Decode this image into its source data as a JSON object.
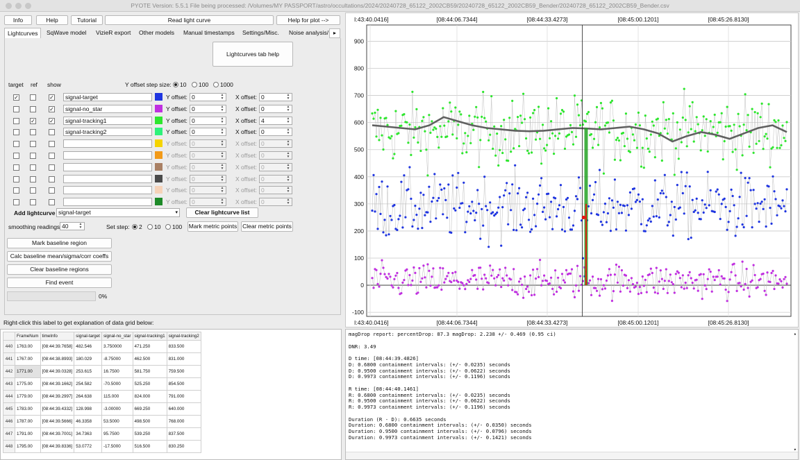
{
  "window": {
    "title": "PYOTE Version: 5.5.1  File being processed: /Volumes/MY PASSPORT/astro/occultations/2024/20240728_65122_2002CB59/20240728_65122_2002CB59_Bender/20240728_65122_2002CB59_Bender.csv"
  },
  "toolbar": {
    "info": "Info",
    "help": "Help",
    "tutorial": "Tutorial",
    "read_light_curve": "Read light curve",
    "help_for_plot": "Help for plot -->"
  },
  "tabs": [
    "Lightcurves",
    "SqWave model",
    "VizieR export",
    "Other models",
    "Manual timestamps",
    "Settings/Misc.",
    "Noise analysis/"
  ],
  "tab_help_button": "Lightcurves tab help",
  "lc_headers": {
    "target": "target",
    "ref": "ref",
    "show": "show"
  },
  "offset_step": {
    "label": "Y offset step size:",
    "options": [
      "10",
      "100",
      "1000"
    ]
  },
  "y_offset_label": "Y offset:",
  "x_offset_label": "X offset:",
  "curves": [
    {
      "name": "signal-target",
      "target": true,
      "ref": false,
      "show": true,
      "color": "#1f35e0",
      "yoff": "0",
      "xoff": "0",
      "enabled": true
    },
    {
      "name": "signal-no_star",
      "target": false,
      "ref": false,
      "show": true,
      "color": "#c02fe0",
      "yoff": "0",
      "xoff": "0",
      "enabled": true
    },
    {
      "name": "signal-tracking1",
      "target": false,
      "ref": true,
      "show": true,
      "color": "#2ee62e",
      "yoff": "0",
      "xoff": "4",
      "enabled": true
    },
    {
      "name": "signal-tracking2",
      "target": false,
      "ref": false,
      "show": false,
      "color": "#2ef27a",
      "yoff": "0",
      "xoff": "0",
      "enabled": true
    },
    {
      "name": "",
      "target": false,
      "ref": false,
      "show": false,
      "color": "#f5d400",
      "yoff": "0",
      "xoff": "0",
      "enabled": false
    },
    {
      "name": "",
      "target": false,
      "ref": false,
      "show": false,
      "color": "#f29a18",
      "yoff": "0",
      "xoff": "0",
      "enabled": false
    },
    {
      "name": "",
      "target": false,
      "ref": false,
      "show": false,
      "color": "#a98064",
      "yoff": "0",
      "xoff": "0",
      "enabled": false
    },
    {
      "name": "",
      "target": false,
      "ref": false,
      "show": false,
      "color": "#4a4a4a",
      "yoff": "0",
      "xoff": "0",
      "enabled": false
    },
    {
      "name": "",
      "target": false,
      "ref": false,
      "show": false,
      "color": "#f6d2b8",
      "yoff": "0",
      "xoff": "0",
      "enabled": false
    },
    {
      "name": "",
      "target": false,
      "ref": false,
      "show": false,
      "color": "#1d8a28",
      "yoff": "0",
      "xoff": "0",
      "enabled": false
    }
  ],
  "add_lightcurve": {
    "label": "Add lightcurve",
    "value": "signal-target"
  },
  "clear_lightcurve_list": "Clear lightcurve list",
  "smoothing": {
    "label": "smoothing readings",
    "value": "40"
  },
  "set_step": {
    "label": "Set step:",
    "options": [
      "2",
      "10",
      "100"
    ]
  },
  "mark_metric_points": "Mark metric points",
  "clear_metric_points": "Clear metric points",
  "actions": [
    "Mark baseline region",
    "Calc baseline mean/sigma/corr coeffs",
    "Clear baseline regions",
    "Find event"
  ],
  "progress": {
    "value": 0,
    "text": "0%"
  },
  "grid_hint": "Right-click this label to get explanation of data grid below:",
  "grid": {
    "columns": [
      "FrameNum",
      "timeInfo",
      "signal-target",
      "signal-no_star",
      "signal-tracking1",
      "signal-tracking2"
    ],
    "rows": [
      {
        "n": "440",
        "cells": [
          "1763.00",
          "[08:44:39.7658]",
          "482.546",
          "3.750000",
          "471.250",
          "833.500"
        ]
      },
      {
        "n": "441",
        "cells": [
          "1767.00",
          "[08:44:38.8993]",
          "180.029",
          "-8.75000",
          "462.500",
          "831.000"
        ]
      },
      {
        "n": "442",
        "cells": [
          "1771.00",
          "[08:44:39.0328]",
          "253.615",
          "16.7500",
          "581.750",
          "759.500"
        ]
      },
      {
        "n": "443",
        "cells": [
          "1775.00",
          "[08:44:39.1662]",
          "254.582",
          "-70.5000",
          "525.250",
          "854.500"
        ]
      },
      {
        "n": "444",
        "cells": [
          "1779.00",
          "[08:44:39.2997]",
          "264.638",
          "115.000",
          "824.000",
          "791.000"
        ]
      },
      {
        "n": "445",
        "cells": [
          "1783.00",
          "[08:44:39.4332]",
          "128.998",
          "-3.00000",
          "669.250",
          "640.000"
        ]
      },
      {
        "n": "446",
        "cells": [
          "1787.00",
          "[08:44:39.5666]",
          "46.3358",
          "53.5000",
          "498.500",
          "768.000"
        ]
      },
      {
        "n": "447",
        "cells": [
          "1791.00",
          "[08:44:39.7001]",
          "34.7363",
          "95.7500",
          "539.250",
          "837.500"
        ]
      },
      {
        "n": "448",
        "cells": [
          "1795.00",
          "[08:44:39.8336]",
          "53.0772",
          "-17.5000",
          "516.500",
          "830.250"
        ]
      }
    ]
  },
  "report_lines": [
    "magDrop report: percentDrop: 87.3 magDrop: 2.238 +/- 0.469 (0.95 ci)",
    "",
    "DNR: 3.49",
    "",
    "D time: [08:44:39.4826]",
    "D: 0.6800 containment intervals: (+/- 0.0235) seconds",
    "D: 0.9500 containment intervals: (+/- 0.0622) seconds",
    "D: 0.9973 containment intervals: (+/- 0.1196) seconds",
    "",
    "R time: [08:44:40.1461]",
    "R: 0.6800 containment intervals: (+/- 0.0235) seconds",
    "R: 0.9500 containment intervals: (+/- 0.0622) seconds",
    "R: 0.9973 containment intervals: (+/- 0.1196) seconds",
    "",
    "Duration (R - D): 0.6635 seconds",
    "Duration: 0.6800 containment intervals: (+/- 0.0350) seconds",
    "Duration: 0.9500 containment intervals: (+/- 0.0796) seconds",
    "Duration: 0.9973 containment intervals: (+/- 0.1421) seconds"
  ],
  "chart_data": {
    "type": "scatter",
    "x_tick_labels": [
      "I:43:40.0416]",
      "[08:44:06.7344]",
      "[08:44:33.4273]",
      "[08:45:00.1201]",
      "[08:45:26.8130]"
    ],
    "y_ticks": [
      -100,
      0,
      100,
      200,
      300,
      400,
      500,
      600,
      700,
      800,
      900
    ],
    "ylim": [
      -115,
      960
    ],
    "grid": true,
    "series": [
      {
        "name": "signal-tracking1",
        "color": "#2ee62e",
        "mean": 570,
        "spread": 90
      },
      {
        "name": "signal-target",
        "color": "#1f35e0",
        "mean": 290,
        "spread": 85
      },
      {
        "name": "signal-no_star",
        "color": "#c02fe0",
        "mean": 15,
        "spread": 45
      }
    ],
    "smoothed_mean": [
      590,
      585,
      580,
      575,
      590,
      620,
      605,
      590,
      580,
      575,
      570,
      568,
      570,
      575,
      580,
      578,
      575,
      580,
      585,
      575,
      560,
      530,
      550,
      565,
      555,
      540,
      560,
      580,
      590,
      565
    ],
    "event_frame_fraction": 0.515
  }
}
